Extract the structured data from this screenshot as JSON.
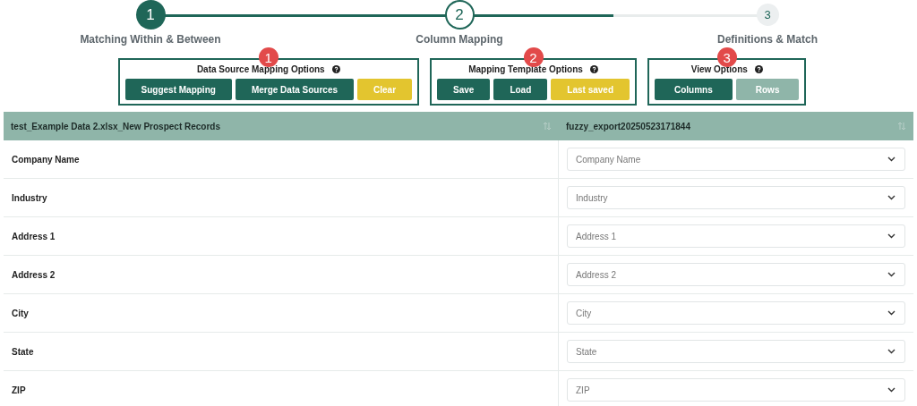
{
  "stepper": {
    "steps": [
      {
        "number": "1",
        "label": "Matching Within & Between",
        "completed": true,
        "selected": false
      },
      {
        "number": "2",
        "label": "Column Mapping",
        "completed": false,
        "selected": true
      },
      {
        "number": "3",
        "label": "Definitions & Match",
        "completed": false,
        "selected": false
      }
    ]
  },
  "option_groups": [
    {
      "badge": "1",
      "title": "Data Source Mapping Options",
      "buttons": [
        {
          "label": "Suggest Mapping",
          "kind": "primary"
        },
        {
          "label": "Merge Data Sources",
          "kind": "primary"
        },
        {
          "label": "Clear",
          "kind": "warning"
        }
      ]
    },
    {
      "badge": "2",
      "title": "Mapping Template Options",
      "buttons": [
        {
          "label": "Save",
          "kind": "primary"
        },
        {
          "label": "Load",
          "kind": "primary"
        },
        {
          "label": "Last saved",
          "kind": "warning"
        }
      ]
    },
    {
      "badge": "3",
      "title": "View Options",
      "buttons": [
        {
          "label": "Columns",
          "kind": "toggle",
          "selected": true
        },
        {
          "label": "Rows",
          "kind": "toggle",
          "selected": false
        }
      ]
    }
  ],
  "table": {
    "columns": [
      "test_Example Data 2.xlsx_New Prospect Records",
      "fuzzy_export20250523171844"
    ],
    "rows": [
      {
        "source": "Company Name",
        "target_placeholder": "Company Name"
      },
      {
        "source": "Industry",
        "target_placeholder": "Industry"
      },
      {
        "source": "Address 1",
        "target_placeholder": "Address 1"
      },
      {
        "source": "Address 2",
        "target_placeholder": "Address 2"
      },
      {
        "source": "City",
        "target_placeholder": "City"
      },
      {
        "source": "State",
        "target_placeholder": "State"
      },
      {
        "source": "ZIP",
        "target_placeholder": "ZIP"
      }
    ]
  }
}
